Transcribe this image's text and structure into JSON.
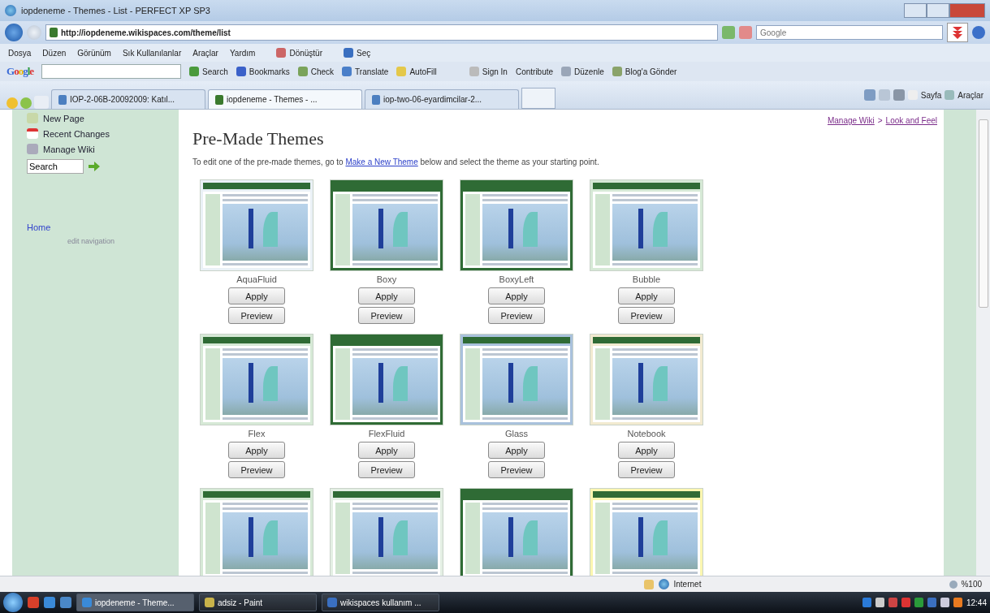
{
  "window": {
    "title": "iopdeneme - Themes - List - PERFECT XP SP3"
  },
  "address_bar": {
    "url": "http://iopdeneme.wikispaces.com/theme/list",
    "search_placeholder": "Google"
  },
  "menu_bar": {
    "items": [
      "Dosya",
      "Düzen",
      "Görünüm",
      "Sık Kullanılanlar",
      "Araçlar",
      "Yardım"
    ],
    "tools": [
      "Dönüştür",
      "Seç"
    ]
  },
  "google_toolbar": {
    "logo": "Google",
    "buttons": [
      "Search",
      "Bookmarks",
      "Check",
      "Translate",
      "AutoFill"
    ],
    "right_buttons": [
      "Sign In",
      "Contribute",
      "Düzenle",
      "Blog'a Gönder"
    ]
  },
  "tabs": [
    {
      "label": "IOP-2-06B-20092009: Katıl...",
      "selected": false
    },
    {
      "label": "iopdeneme - Themes - ...",
      "selected": true
    },
    {
      "label": "iop-two-06-eyardimcilar-2...",
      "selected": false
    }
  ],
  "command_bar": [
    "Sayfa",
    "Araçlar"
  ],
  "sidebar": {
    "items": [
      "New Page",
      "Recent Changes",
      "Manage Wiki"
    ],
    "search_value": "Search",
    "nav": [
      "Home"
    ],
    "edit_link": "edit navigation"
  },
  "breadcrumb": {
    "items": [
      "Manage Wiki",
      "Look and Feel"
    ],
    "separator": ">"
  },
  "page": {
    "heading": "Pre-Made Themes",
    "intro_before": "To edit one of the pre-made themes, go to ",
    "intro_link": "Make a New Theme",
    "intro_after": " below and select the theme as your starting point."
  },
  "themes": [
    {
      "name": "AquaFluid",
      "color": "#eaf1f6",
      "apply": "Apply",
      "preview": "Preview"
    },
    {
      "name": "Boxy",
      "color": "#2f6b35",
      "apply": "Apply",
      "preview": "Preview"
    },
    {
      "name": "BoxyLeft",
      "color": "#2f6b35",
      "apply": "Apply",
      "preview": "Preview"
    },
    {
      "name": "Bubble",
      "color": "#d6e9d6",
      "apply": "Apply",
      "preview": "Preview"
    },
    {
      "name": "Flex",
      "color": "#d6e9d6",
      "apply": "Apply",
      "preview": "Preview"
    },
    {
      "name": "FlexFluid",
      "color": "#2f6b35",
      "apply": "Apply",
      "preview": "Preview"
    },
    {
      "name": "Glass",
      "color": "#a9c1dc",
      "apply": "Apply",
      "preview": "Preview"
    },
    {
      "name": "Notebook",
      "color": "#f2ead0",
      "apply": "Apply",
      "preview": "Preview"
    }
  ],
  "partial_themes": [
    {
      "color": "#d6e9d6"
    },
    {
      "color": "#e4efe4"
    },
    {
      "color": "#2f6b35"
    },
    {
      "color": "#fbf6b0"
    }
  ],
  "status_bar": {
    "zone": "Internet",
    "zoom": "%100"
  },
  "taskbar": {
    "items": [
      {
        "label": "iopdeneme - Theme...",
        "selected": true
      },
      {
        "label": "adsiz - Paint",
        "selected": false
      },
      {
        "label": "wikispaces kullanım ...",
        "selected": false
      }
    ],
    "clock": "12:44"
  }
}
